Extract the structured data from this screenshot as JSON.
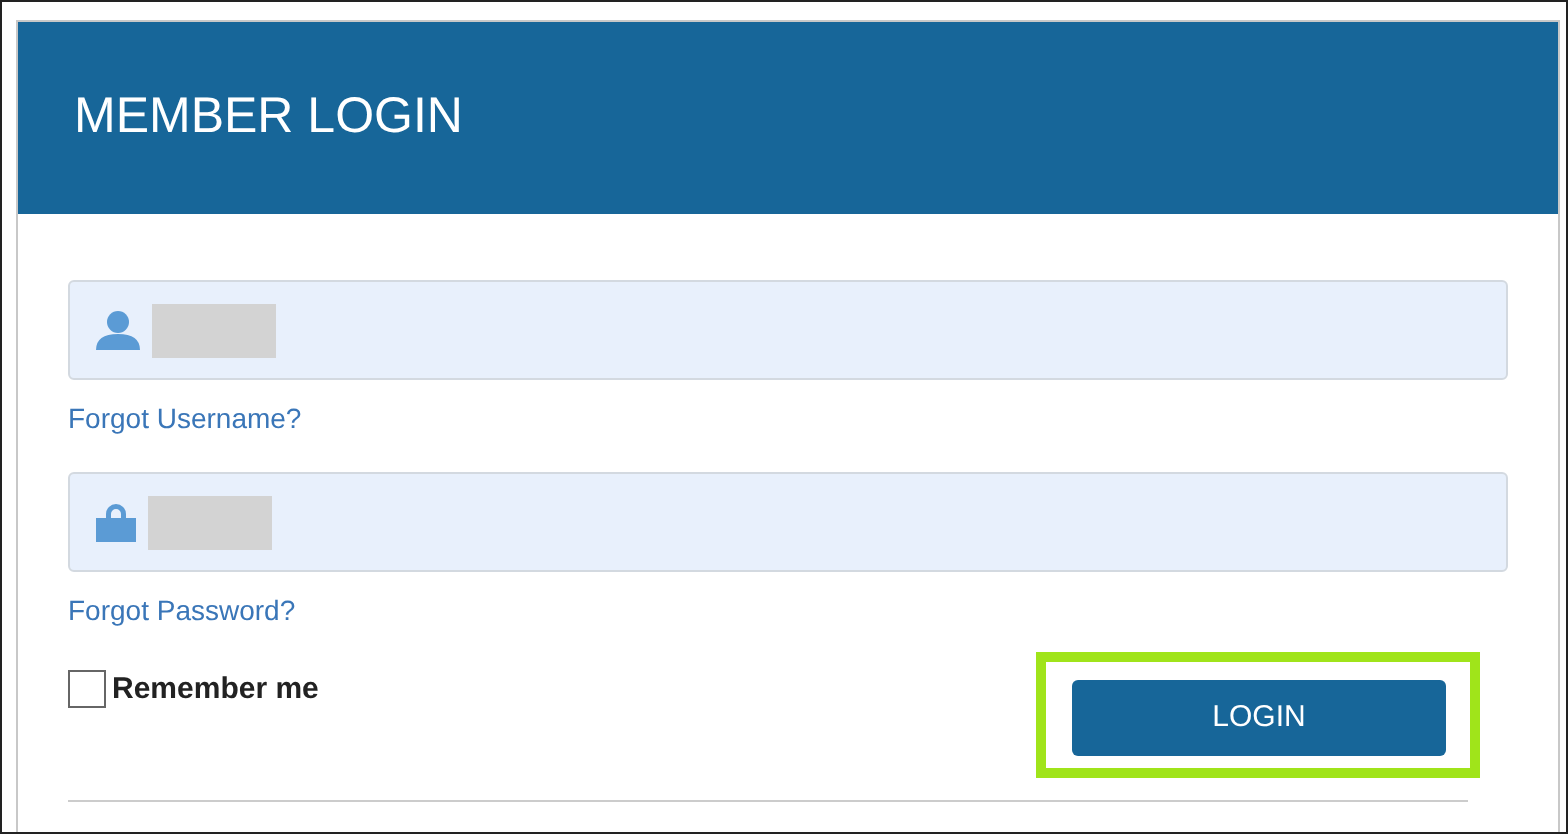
{
  "header": {
    "title": "MEMBER LOGIN"
  },
  "fields": [
    {
      "kind": "username",
      "redacted": true,
      "link": "Forgot Username?"
    },
    {
      "kind": "password",
      "redacted": true,
      "link": "Forgot Password?"
    }
  ],
  "remember": {
    "label": "Remember me",
    "checked": false
  },
  "login_button": {
    "label": "LOGIN",
    "highlighted": true
  }
}
